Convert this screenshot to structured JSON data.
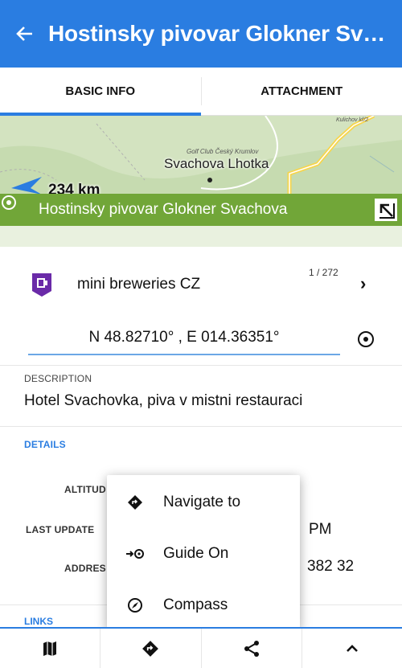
{
  "app_bar": {
    "title": "Hostinsky pivovar Glokner Sva..."
  },
  "tabs": [
    {
      "label": "BASIC INFO",
      "active": true
    },
    {
      "label": "ATTACHMENT",
      "active": false
    }
  ],
  "map": {
    "place_name": "Svachova Lhotka",
    "golf_label": "Golf Club Český Krumlov",
    "corner_label": "Kulichov kř/2",
    "distance": "234 km",
    "point_name": "Hostinsky pivovar Glokner Svachova"
  },
  "category": {
    "name": "mini breweries CZ",
    "position": "1 / 272",
    "icon": "brewery-pin-icon",
    "color": "#6a2aa8"
  },
  "coordinates": "N 48.82710° , E 014.36351°",
  "description": {
    "label": "DESCRIPTION",
    "text": "Hotel Svachovka, piva v mistni restauraci"
  },
  "details": {
    "label": "DETAILS",
    "altitude_label": "ALTITUD",
    "last_update_label": "LAST UPDATE",
    "last_update_value": "PM",
    "address_label": "ADDRES",
    "address_value": "382 32"
  },
  "links_label": "LINKS",
  "popup_menu": [
    {
      "label": "Navigate to",
      "icon": "navigate-diamond-icon"
    },
    {
      "label": "Guide On",
      "icon": "guide-target-icon"
    },
    {
      "label": "Compass",
      "icon": "compass-icon"
    }
  ],
  "bottom_bar": [
    "map-icon",
    "navigate-icon",
    "share-icon",
    "expand-up-icon"
  ],
  "colors": {
    "primary": "#2a7de1",
    "map_strip": "#71a638",
    "category": "#6a2aa8"
  }
}
